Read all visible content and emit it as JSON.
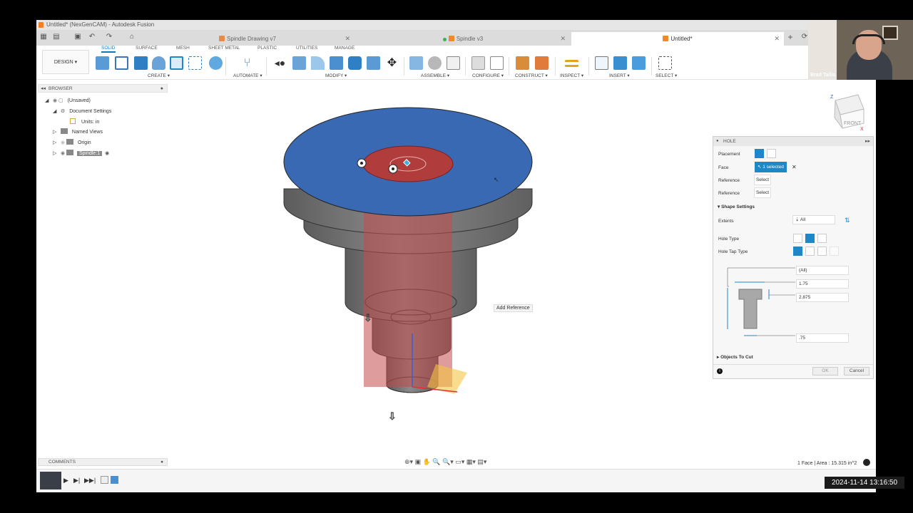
{
  "window": {
    "title": "Untitled* (NexGenCAM) - Autodesk Fusion"
  },
  "doc_tabs": [
    {
      "label": "Spindle Drawing v7"
    },
    {
      "label": "Spindle v3"
    },
    {
      "label": "Untitled*"
    }
  ],
  "toolbar": {
    "workspace": "DESIGN",
    "tabs": [
      "SOLID",
      "SURFACE",
      "MESH",
      "SHEET METAL",
      "PLASTIC",
      "UTILITIES",
      "MANAGE"
    ],
    "groups": [
      "CREATE",
      "AUTOMATE",
      "MODIFY",
      "ASSEMBLE",
      "CONFIGURE",
      "CONSTRUCT",
      "INSPECT",
      "INSERT",
      "SELECT"
    ]
  },
  "browser": {
    "title": "BROWSER",
    "items": [
      {
        "label": "(Unsaved)"
      },
      {
        "label": "Document Settings"
      },
      {
        "label": "Units: in"
      },
      {
        "label": "Named Views"
      },
      {
        "label": "Origin"
      },
      {
        "label": "Spindle:1"
      }
    ]
  },
  "viewport": {
    "tooltip": "Add Reference",
    "viewcube_label": "FRONT",
    "status": "1 Face | Area : 15.315 in^2"
  },
  "hole_panel": {
    "title": "HOLE",
    "placement_label": "Placement",
    "face_label": "Face",
    "face_value": "1 selected",
    "reference_label": "Reference",
    "select_label": "Select",
    "shape_settings": "Shape Settings",
    "extents_label": "Extents",
    "extents_value": "All",
    "hole_type_label": "Hole Type",
    "hole_tap_type_label": "Hole Tap Type",
    "dims": {
      "depth": "(All)",
      "cbore_diameter": "1.75",
      "cbore_depth": "2.875",
      "diameter": ".75"
    },
    "objects_to_cut": "Objects To Cut",
    "ok": "OK",
    "cancel": "Cancel"
  },
  "comments": {
    "title": "COMMENTS"
  },
  "webcam": {
    "name": "Brad Tallis"
  },
  "timestamp": "2024-11-14 13:16:50",
  "colors": {
    "accent": "#1d87c8",
    "top_face": "#3a69b4",
    "body": "#6f6f6f",
    "hole": "#b04848"
  }
}
